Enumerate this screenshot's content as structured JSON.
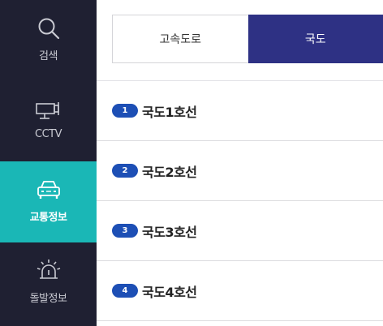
{
  "sidebar": {
    "items": [
      {
        "label": "검색",
        "icon": "search-icon"
      },
      {
        "label": "CCTV",
        "icon": "cctv-camera-icon"
      },
      {
        "label": "교통정보",
        "icon": "car-icon",
        "active": true
      },
      {
        "label": "돌발정보",
        "icon": "alert-siren-icon"
      }
    ]
  },
  "tabs": [
    {
      "label": "고속도로",
      "active": false
    },
    {
      "label": "국도",
      "active": true
    }
  ],
  "routes": [
    {
      "number": "1",
      "name": "국도1호선"
    },
    {
      "number": "2",
      "name": "국도2호선"
    },
    {
      "number": "3",
      "name": "국도3호선"
    },
    {
      "number": "4",
      "name": "국도4호선"
    }
  ],
  "colors": {
    "sidebar_bg": "#1f2032",
    "active_nav_bg": "#1ab7b6",
    "active_tab_bg": "#2e3184",
    "badge_bg": "#1d4fb5"
  }
}
